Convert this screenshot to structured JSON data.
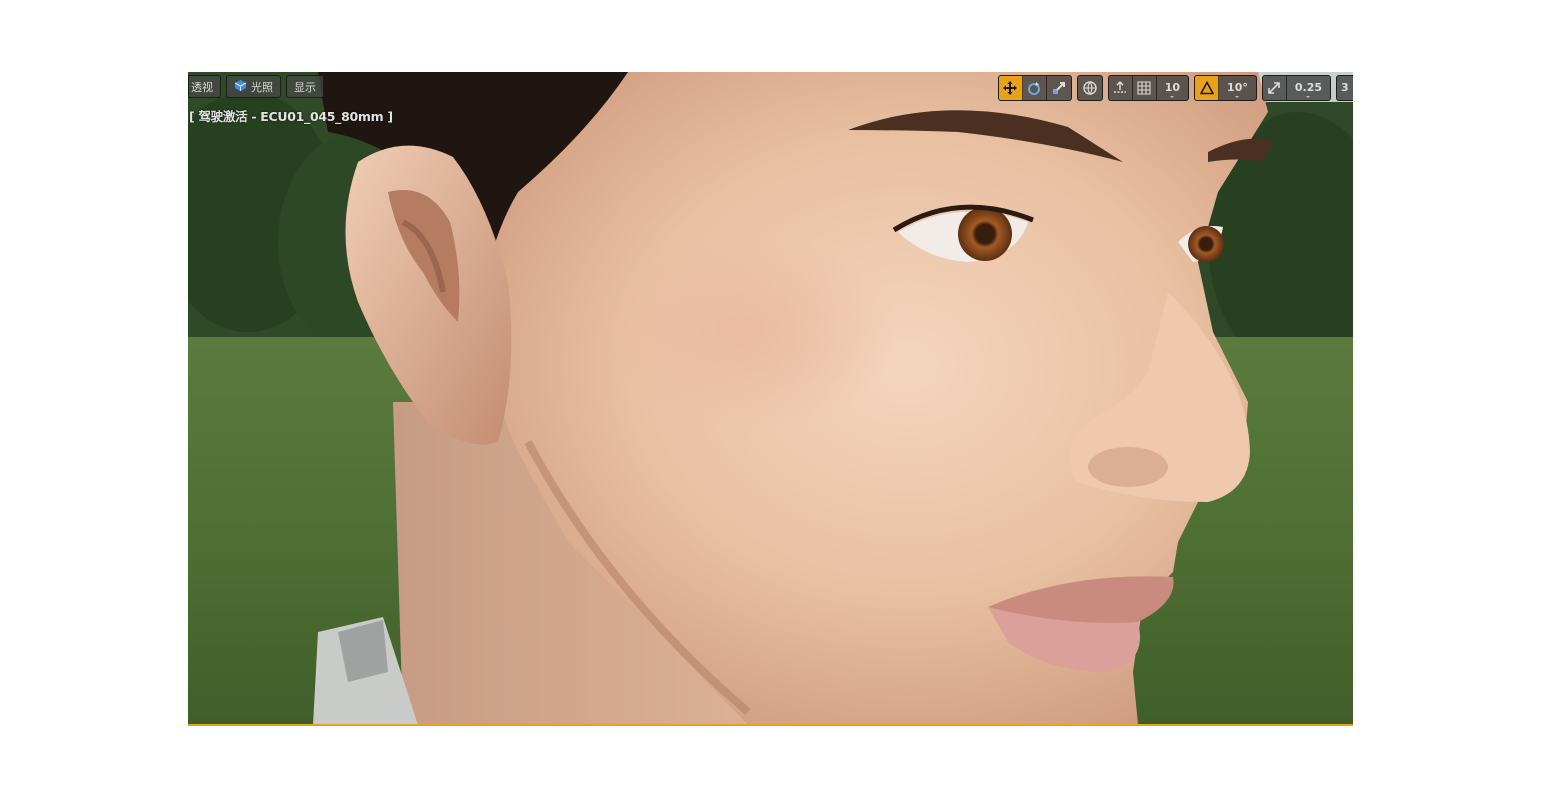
{
  "viewport": {
    "toolbar_left": {
      "perspective_label": "透视",
      "lighting_label": "光照",
      "show_label": "显示"
    },
    "camera_label": "[ 驾驶激活 - ECU01_045_80mm ]",
    "toolbar_right": {
      "grid_snap_value": "10",
      "rotation_snap_value": "10°",
      "scale_snap_value": "0.25",
      "camera_speed_label": "3"
    },
    "accent_color": "#e8a21a"
  }
}
